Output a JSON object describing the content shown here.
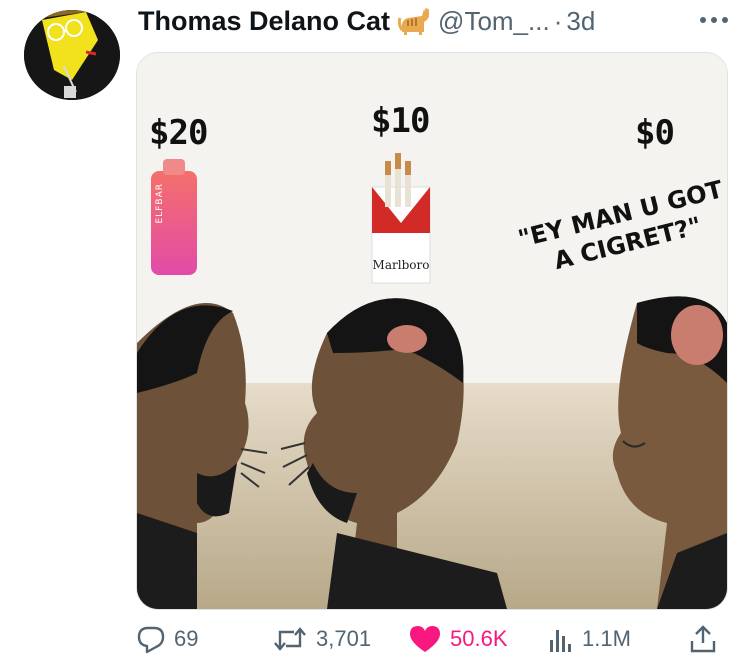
{
  "author": {
    "display_name": "Thomas Delano Cat",
    "emoji_icon": "cat-emoji-icon",
    "handle": "@Tom_...",
    "separator": "·",
    "time": "3d"
  },
  "media": {
    "price_left": "$20",
    "price_middle": "$10",
    "price_right": "$0",
    "quote_line1": "\"EY MAN U GOT",
    "quote_line2": "A CIGRET?\"",
    "vape_brand": "ELFBAR",
    "pack_brand": "Marlboro"
  },
  "actions": {
    "replies": "69",
    "retweets": "3,701",
    "likes": "50.6K",
    "views": "1.1M"
  },
  "colors": {
    "like": "#f91880",
    "secondary_text": "#536471",
    "primary_text": "#0f1419"
  }
}
